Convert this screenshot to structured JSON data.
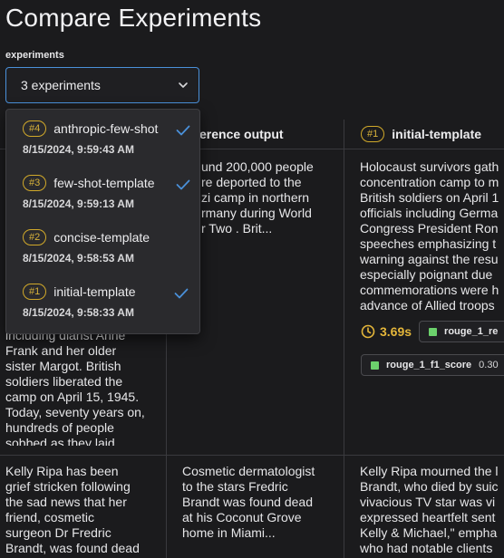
{
  "page": {
    "title": "Compare Experiments"
  },
  "filter": {
    "label": "experiments",
    "value": "3 experiments"
  },
  "dropdown": {
    "options": [
      {
        "badge": "#4",
        "label": "anthropic-few-shot",
        "date": "8/15/2024, 9:59:43 AM",
        "selected": true
      },
      {
        "badge": "#3",
        "label": "few-shot-template",
        "date": "8/15/2024, 9:59:13 AM",
        "selected": true
      },
      {
        "badge": "#2",
        "label": "concise-template",
        "date": "8/15/2024, 9:58:53 AM",
        "selected": false
      },
      {
        "badge": "#1",
        "label": "initial-template",
        "date": "8/15/2024, 9:58:33 AM",
        "selected": true
      }
    ]
  },
  "table": {
    "headers": {
      "reference": "erence output",
      "experiment": {
        "badge": "#1",
        "name": "initial-template"
      }
    },
    "rows": [
      {
        "input_partial_lines": [
          "including diarist Anne",
          "Frank and her older",
          "sister Margot. British",
          "soldiers liberated the",
          "camp on April 15, 1945.",
          "Today, seventy years on,",
          "hundreds of people",
          "sobbed as they laid"
        ],
        "reference_lines": [
          "und 200,000 people",
          "re deported to the",
          "zi camp in northern",
          "rmany during World",
          "r Two . Brit..."
        ],
        "output_lines": [
          "Holocaust survivors gath",
          "concentration camp to m",
          "British soldiers on April 1",
          "officials including Germa",
          "Congress President Ron",
          "speeches emphasizing t",
          "warning against the resu",
          "especially poignant due",
          "commemorations were h",
          "advance of Allied troops"
        ],
        "metrics": {
          "duration": "3.69s",
          "score1_name": "rouge_1_re",
          "score2_name": "rouge_1_f1_score",
          "score2_value": "0.30"
        }
      },
      {
        "input_lines": [
          "Kelly Ripa has been",
          "grief stricken following",
          "the sad news that her",
          "friend, cosmetic",
          "surgeon Dr Fredric",
          "Brandt, was found dead"
        ],
        "reference_lines": [
          "Cosmetic dermatologist",
          "to the stars Fredric",
          "Brandt was found dead",
          "at his Coconut Grove",
          "home in Miami..."
        ],
        "output_lines": [
          "Kelly Ripa mourned the l",
          "Brandt, who died by suic",
          "vivacious TV star was vi",
          "expressed heartfelt sent",
          "Kelly & Michael,\" empha",
          "who had notable clients"
        ]
      }
    ]
  },
  "colors": {
    "accent": "#4a90d9",
    "badge": "#d1a92a",
    "score": "#6cd16c",
    "background": "#1b1b1d"
  }
}
